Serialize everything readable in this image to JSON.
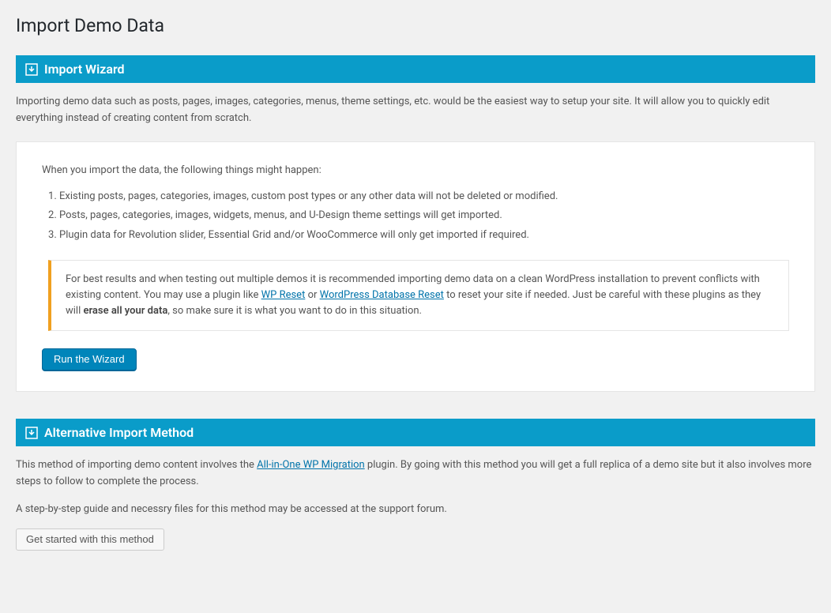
{
  "page": {
    "title": "Import Demo Data"
  },
  "wizard": {
    "header": "Import Wizard",
    "intro": "Importing demo data such as posts, pages, images, categories, menus, theme settings, etc. would be the easiest way to setup your site. It will allow you to quickly edit everything instead of creating content from scratch.",
    "panel_lead": "When you import the data, the following things might happen:",
    "items": [
      "Existing posts, pages, categories, images, custom post types or any other data will not be deleted or modified.",
      "Posts, pages, categories, images, widgets, menus, and U-Design theme settings will get imported.",
      "Plugin data for Revolution slider, Essential Grid and/or WooCommerce will only get imported if required."
    ],
    "notice": {
      "part1": "For best results and when testing out multiple demos it is recommended importing demo data on a clean WordPress installation to prevent conflicts with existing content. You may use a plugin like ",
      "link1": "WP Reset",
      "or": " or ",
      "link2": "WordPress Database Reset",
      "part2": " to reset your site if needed. Just be careful with these plugins as they will ",
      "strong": "erase all your data",
      "part3": ", so make sure it is what you want to do in this situation."
    },
    "button": "Run the Wizard"
  },
  "alternative": {
    "header": "Alternative Import Method",
    "p1a": "This method of importing demo content involves the ",
    "p1link": "All-in-One WP Migration",
    "p1b": " plugin. By going with this method you will get a full replica of a demo site but it also involves more steps to follow to complete the process.",
    "p2": "A step-by-step guide and necessry files for this method may be accessed at the support forum.",
    "button": "Get started with this method"
  }
}
